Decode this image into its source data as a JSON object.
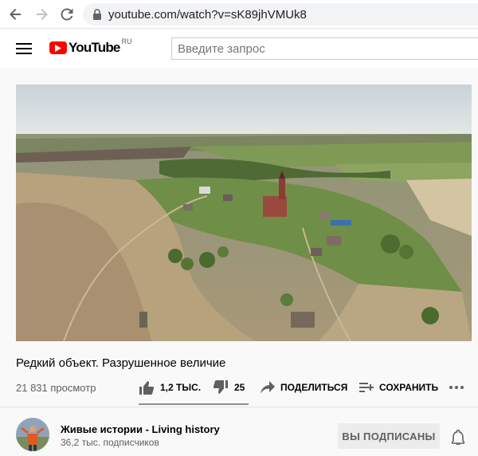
{
  "browser": {
    "url": "youtube.com/watch?v=sK89jhVMUk8"
  },
  "header": {
    "logo_text": "YouTube",
    "logo_region": "RU",
    "search_placeholder": "Введите запрос"
  },
  "video": {
    "title": "Редкий объект. Разрушенное величие",
    "views": "21 831 просмотр",
    "likes": "1,2 ТЫС.",
    "dislikes": "25",
    "share_label": "ПОДЕЛИТЬСЯ",
    "save_label": "СОХРАНИТЬ"
  },
  "channel": {
    "name": "Живые истории - Living history",
    "subscribers": "36,2 тыс. подписчиков",
    "subscribe_label": "ВЫ ПОДПИСАНЫ"
  },
  "colors": {
    "brand_red": "#ff0000",
    "text_primary": "#030303",
    "text_secondary": "#606060",
    "page_background": "#f9f9f9"
  },
  "icons": [
    "back-arrow-icon",
    "forward-arrow-icon",
    "reload-icon",
    "lock-icon",
    "menu-icon",
    "youtube-logo-icon",
    "thumb-up-icon",
    "thumb-down-icon",
    "share-icon",
    "playlist-add-icon",
    "more-icon",
    "bell-icon"
  ]
}
